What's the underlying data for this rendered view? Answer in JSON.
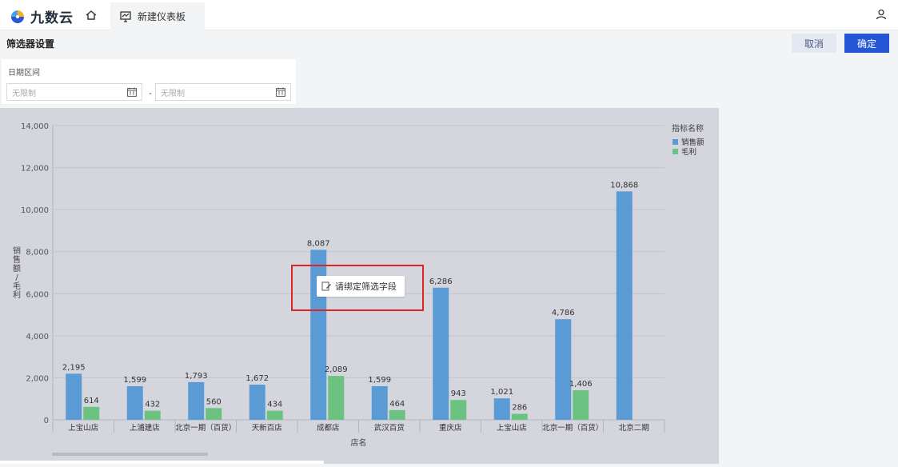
{
  "app": {
    "name": "九数云",
    "brand_color": "#2456d6"
  },
  "tab": {
    "label": "新建仪表板",
    "icon": "dashboard-icon"
  },
  "filter_header": {
    "title": "筛选器设置",
    "cancel_label": "取消",
    "ok_label": "确定"
  },
  "date_filter": {
    "label": "日期区间",
    "start_placeholder": "无限制",
    "end_placeholder": "无限制",
    "separator": "-"
  },
  "hint": {
    "text": "请绑定筛选字段",
    "icon": "edit-icon"
  },
  "chart_data": {
    "type": "bar",
    "xlabel": "店名",
    "ylabel": "销售额/毛利",
    "ylim": [
      0,
      14000
    ],
    "yticks": [
      "0",
      "2,000",
      "4,000",
      "6,000",
      "8,000",
      "10,000",
      "12,000",
      "14,000"
    ],
    "legend_title": "指标名称",
    "legend_position": "right",
    "grid": true,
    "categories": [
      "上宝山店",
      "上浦建店",
      "北京一期（百货）",
      "天新百店",
      "成都店",
      "武汉百货",
      "重庆店",
      "上宝山店",
      "北京一期（百货）",
      "北京二期"
    ],
    "series": [
      {
        "name": "销售额",
        "color": "#5b9bd5",
        "values": [
          2195,
          1599,
          1793,
          1672,
          8087,
          1599,
          6286,
          1021,
          4786,
          10868
        ],
        "labels": [
          "2,195",
          "1,599",
          "1,793",
          "1,672",
          "8,087",
          "1,599",
          "6,286",
          "1,021",
          "4,786",
          "10,868"
        ]
      },
      {
        "name": "毛利",
        "color": "#6cc381",
        "values": [
          614,
          432,
          560,
          434,
          2089,
          464,
          943,
          286,
          1406,
          null
        ],
        "labels": [
          "614",
          "432",
          "560",
          "434",
          "2,089",
          "464",
          "943",
          "286",
          "1,406",
          ""
        ]
      }
    ]
  }
}
